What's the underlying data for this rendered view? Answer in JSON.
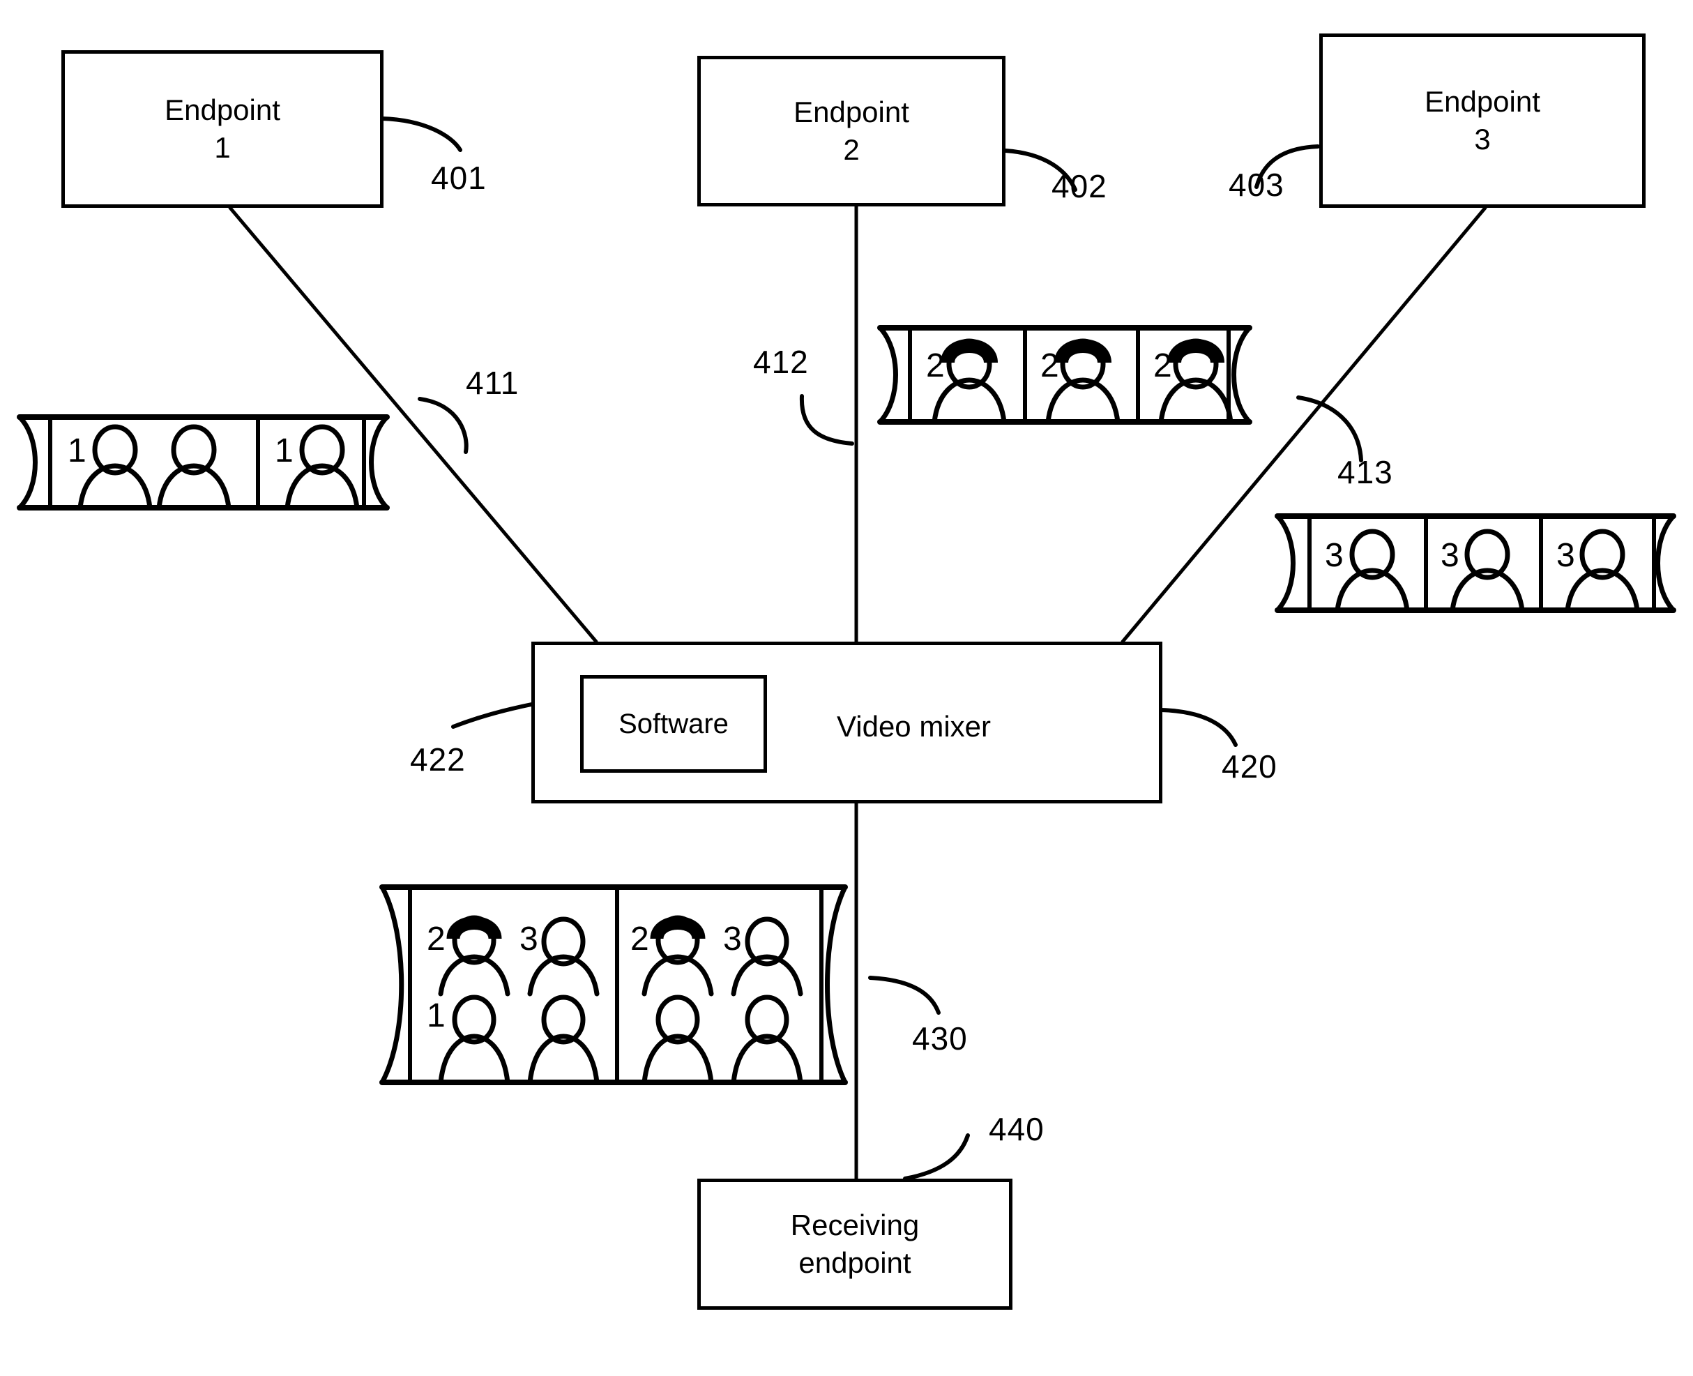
{
  "figure": {
    "title": "Video mixer conferencing diagram",
    "stroke_color": "#000000",
    "background_color": "#ffffff"
  },
  "nodes": [
    {
      "id": "endpoint-1",
      "line1": "Endpoint",
      "line2": "1",
      "ref": "401"
    },
    {
      "id": "endpoint-2",
      "line1": "Endpoint",
      "line2": "2",
      "ref": "402"
    },
    {
      "id": "endpoint-3",
      "line1": "Endpoint",
      "line2": "3",
      "ref": "403"
    },
    {
      "id": "receiving-endpoint",
      "line1": "Receiving",
      "line2": "endpoint",
      "ref": "440"
    }
  ],
  "mixer": {
    "label": "Video mixer",
    "ref": "420",
    "software": {
      "label": "Software",
      "ref": "422"
    }
  },
  "streams": [
    {
      "id": "stream-411",
      "ref": "411",
      "source": "Endpoint 1",
      "frames": 2,
      "persons_per_frame": 2,
      "frame_labels": [
        "1",
        "1"
      ],
      "hair": false
    },
    {
      "id": "stream-412",
      "ref": "412",
      "source": "Endpoint 2",
      "frames": 3,
      "persons_per_frame": 1,
      "frame_labels": [
        "2",
        "2",
        "2"
      ],
      "hair": true
    },
    {
      "id": "stream-413",
      "ref": "413",
      "source": "Endpoint 3",
      "frames": 3,
      "persons_per_frame": 1,
      "frame_labels": [
        "3",
        "3",
        "3"
      ],
      "hair": false
    },
    {
      "id": "stream-430",
      "ref": "430",
      "source": "Video mixer output",
      "frames": 2,
      "persons_per_frame": 4,
      "frame_labels": [
        [
          "2",
          "3",
          "1",
          ""
        ],
        [
          "2",
          "3",
          "",
          ""
        ]
      ],
      "hair_positions": [
        "top-left"
      ]
    }
  ],
  "ref_numbers": [
    "401",
    "402",
    "403",
    "411",
    "412",
    "413",
    "420",
    "422",
    "430",
    "440"
  ]
}
